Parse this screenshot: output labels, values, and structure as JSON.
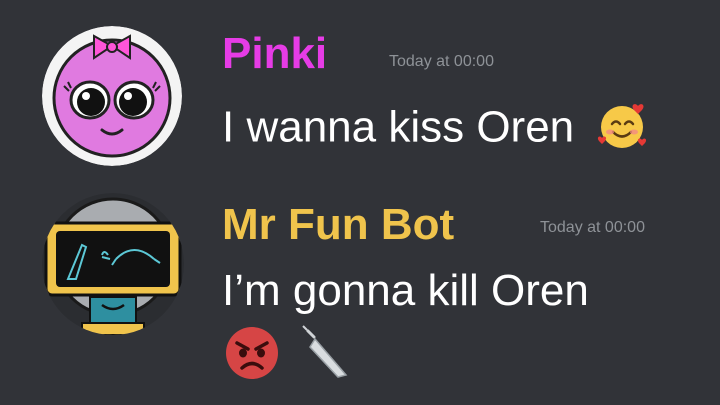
{
  "messages": [
    {
      "username": "Pinki",
      "username_color": "#e63ce6",
      "timestamp": "Today at 00:00",
      "text": "I wanna kiss Oren",
      "emojis": [
        "smiling-face-with-hearts-icon"
      ],
      "avatar": "pinki-avatar"
    },
    {
      "username": "Mr Fun Bot",
      "username_color": "#f0c44c",
      "timestamp": "Today at 00:00",
      "text": "I’m gonna kill Oren",
      "emojis": [
        "angry-face-icon",
        "knife-icon"
      ],
      "avatar": "mr-fun-bot-avatar"
    }
  ]
}
